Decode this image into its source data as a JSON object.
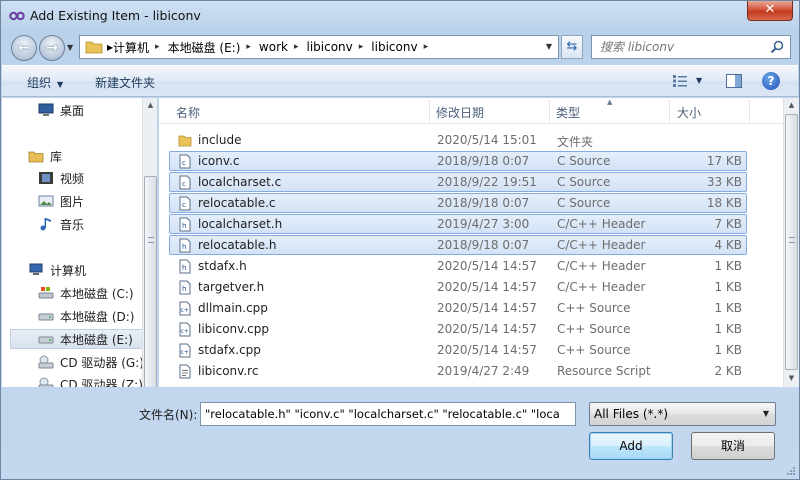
{
  "window": {
    "title": "Add Existing Item - libiconv",
    "close_glyph": "✕",
    "accent": "#3c7fb1"
  },
  "address": {
    "crumbs": [
      "计算机",
      "本地磁盘 (E:)",
      "work",
      "libiconv",
      "libiconv"
    ],
    "search_placeholder": "搜索 libiconv"
  },
  "toolbar": {
    "organize_label": "组织",
    "new_folder_label": "新建文件夹",
    "help_glyph": "?"
  },
  "navpane": {
    "items": [
      {
        "label": "桌面",
        "icon": "desktop-icon"
      },
      {
        "label": "库",
        "icon": "library-icon"
      },
      {
        "label": "视频",
        "icon": "video-icon"
      },
      {
        "label": "图片",
        "icon": "pictures-icon"
      },
      {
        "label": "音乐",
        "icon": "music-icon"
      },
      {
        "label": "计算机",
        "icon": "computer-icon"
      },
      {
        "label": "本地磁盘 (C:)",
        "icon": "drive-c-icon"
      },
      {
        "label": "本地磁盘 (D:)",
        "icon": "drive-icon"
      },
      {
        "label": "本地磁盘 (E:)",
        "icon": "drive-icon",
        "selected": true
      },
      {
        "label": "CD 驱动器 (G:)",
        "icon": "cd-drive-icon"
      },
      {
        "label": "CD 驱动器 (Z:)",
        "icon": "cd-drive-icon"
      }
    ]
  },
  "filelist": {
    "columns": [
      "名称",
      "修改日期",
      "类型",
      "大小"
    ],
    "rows": [
      {
        "name": "include",
        "date": "2020/5/14 15:01",
        "type": "文件夹",
        "size": "",
        "icon": "folder-icon",
        "selected": false
      },
      {
        "name": "iconv.c",
        "date": "2018/9/18 0:07",
        "type": "C Source",
        "size": "17 KB",
        "icon": "c-source-icon",
        "selected": true
      },
      {
        "name": "localcharset.c",
        "date": "2018/9/22 19:51",
        "type": "C Source",
        "size": "33 KB",
        "icon": "c-source-icon",
        "selected": true
      },
      {
        "name": "relocatable.c",
        "date": "2018/9/18 0:07",
        "type": "C Source",
        "size": "18 KB",
        "icon": "c-source-icon",
        "selected": true
      },
      {
        "name": "localcharset.h",
        "date": "2019/4/27 3:00",
        "type": "C/C++ Header",
        "size": "7 KB",
        "icon": "header-file-icon",
        "selected": true
      },
      {
        "name": "relocatable.h",
        "date": "2018/9/18 0:07",
        "type": "C/C++ Header",
        "size": "4 KB",
        "icon": "header-file-icon",
        "selected": true
      },
      {
        "name": "stdafx.h",
        "date": "2020/5/14 14:57",
        "type": "C/C++ Header",
        "size": "1 KB",
        "icon": "header-file-icon",
        "selected": false
      },
      {
        "name": "targetver.h",
        "date": "2020/5/14 14:57",
        "type": "C/C++ Header",
        "size": "1 KB",
        "icon": "header-file-icon",
        "selected": false
      },
      {
        "name": "dllmain.cpp",
        "date": "2020/5/14 14:57",
        "type": "C++ Source",
        "size": "1 KB",
        "icon": "cpp-source-icon",
        "selected": false
      },
      {
        "name": "libiconv.cpp",
        "date": "2020/5/14 14:57",
        "type": "C++ Source",
        "size": "1 KB",
        "icon": "cpp-source-icon",
        "selected": false
      },
      {
        "name": "stdafx.cpp",
        "date": "2020/5/14 14:57",
        "type": "C++ Source",
        "size": "1 KB",
        "icon": "cpp-source-icon",
        "selected": false
      },
      {
        "name": "libiconv.rc",
        "date": "2019/4/27 2:49",
        "type": "Resource Script",
        "size": "2 KB",
        "icon": "resource-script-icon",
        "selected": false
      }
    ]
  },
  "bottom": {
    "filename_label": "文件名(N):",
    "filename_value": "\"relocatable.h\" \"iconv.c\" \"localcharset.c\" \"relocatable.c\" \"loca",
    "filetype_value": "All Files (*.*)",
    "add_label": "Add",
    "cancel_label": "取消"
  }
}
